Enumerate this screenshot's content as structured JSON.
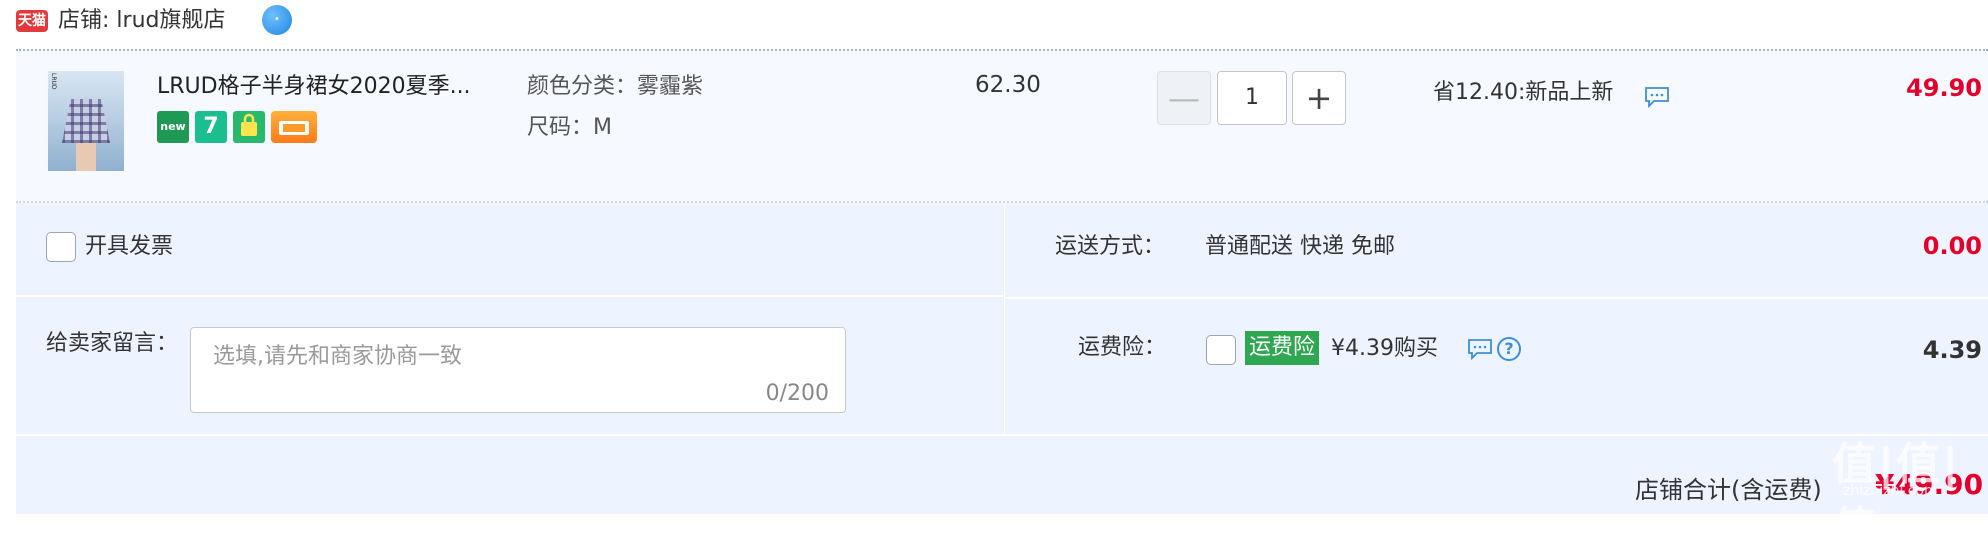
{
  "shop": {
    "badge_text": "天猫",
    "label": "店铺: lrud旗舰店",
    "wangwang_icon": "wangwang-chat-icon"
  },
  "item": {
    "title": "LRUD格子半身裙女2020夏季...",
    "thumb_tag": "LRUD",
    "badges": [
      "new",
      "7",
      "bag",
      "card"
    ],
    "color_label": "颜色分类：",
    "color_value": "雾霾紫",
    "size_label": "尺码：",
    "size_value": "M",
    "unit_price": "62.30",
    "minus_label": "—",
    "quantity": "1",
    "plus_label": "+",
    "saving_text": "省12.40:新品上新",
    "total": "49.90"
  },
  "options": {
    "invoice_label": "开具发票",
    "delivery_label": "运送方式：",
    "delivery_value": "普通配送 快递 免邮",
    "delivery_fee": "0.00",
    "message_label": "给卖家留言：",
    "message_placeholder": "选填,请先和商家协商一致",
    "message_counter": "0/200",
    "insurance_label": "运费险：",
    "insurance_tag": "运费险",
    "insurance_text": "¥4.39购买",
    "insurance_fee": "4.39"
  },
  "summary": {
    "store_total_label": "店铺合计(含运费)",
    "store_total_value": "¥49.90"
  },
  "watermark": {
    "main": "值|值|值",
    "sub": "zhizhizhi.com"
  },
  "colors": {
    "price_red": "#e4002b",
    "tmall_red": "#e4393c",
    "insurance_green": "#2fa650",
    "link_blue": "#3d8fd6"
  }
}
